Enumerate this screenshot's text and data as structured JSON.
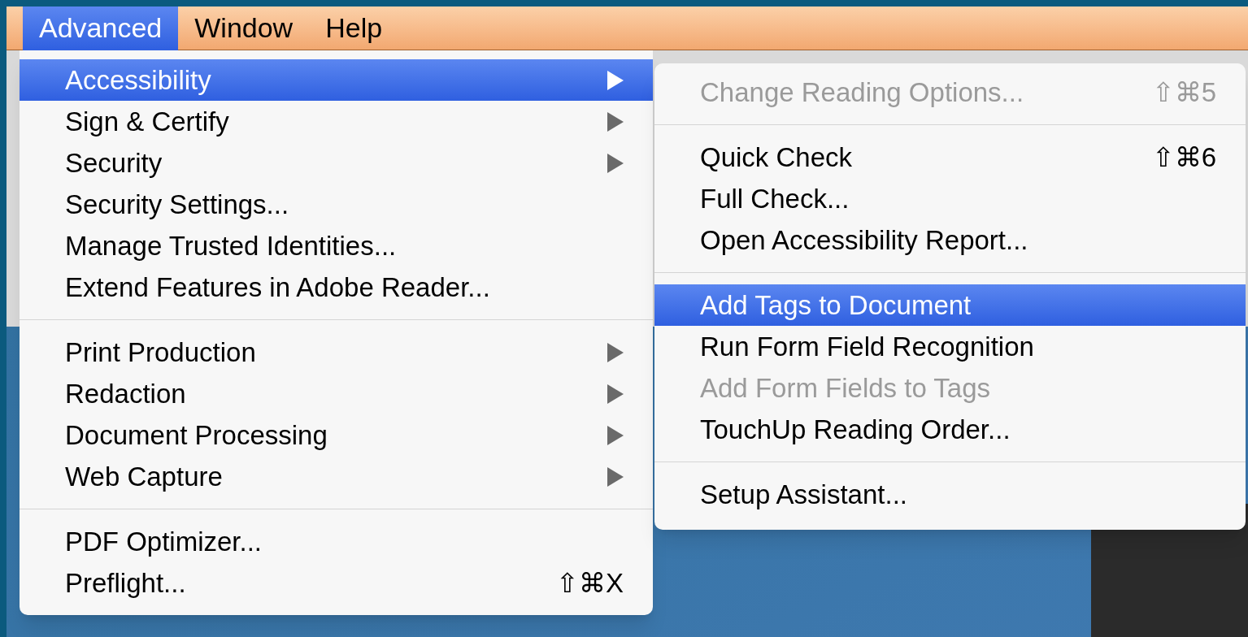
{
  "menubar": [
    {
      "label": "Advanced",
      "selected": true
    },
    {
      "label": "Window",
      "selected": false
    },
    {
      "label": "Help",
      "selected": false
    }
  ],
  "menu": [
    {
      "kind": "item",
      "label": "Accessibility",
      "has_submenu": true,
      "selected": true,
      "disabled": false
    },
    {
      "kind": "item",
      "label": "Sign & Certify",
      "has_submenu": true,
      "selected": false,
      "disabled": false
    },
    {
      "kind": "item",
      "label": "Security",
      "has_submenu": true,
      "selected": false,
      "disabled": false
    },
    {
      "kind": "item",
      "label": "Security Settings...",
      "has_submenu": false,
      "selected": false,
      "disabled": false
    },
    {
      "kind": "item",
      "label": "Manage Trusted Identities...",
      "has_submenu": false,
      "selected": false,
      "disabled": false
    },
    {
      "kind": "item",
      "label": "Extend Features in Adobe Reader...",
      "has_submenu": false,
      "selected": false,
      "disabled": false
    },
    {
      "kind": "separator"
    },
    {
      "kind": "item",
      "label": "Print Production",
      "has_submenu": true,
      "selected": false,
      "disabled": false
    },
    {
      "kind": "item",
      "label": "Redaction",
      "has_submenu": true,
      "selected": false,
      "disabled": false
    },
    {
      "kind": "item",
      "label": "Document Processing",
      "has_submenu": true,
      "selected": false,
      "disabled": false
    },
    {
      "kind": "item",
      "label": "Web Capture",
      "has_submenu": true,
      "selected": false,
      "disabled": false
    },
    {
      "kind": "separator"
    },
    {
      "kind": "item",
      "label": "PDF Optimizer...",
      "has_submenu": false,
      "selected": false,
      "disabled": false
    },
    {
      "kind": "item",
      "label": "Preflight...",
      "shortcut": "⇧⌘X",
      "has_submenu": false,
      "selected": false,
      "disabled": false
    }
  ],
  "submenu": [
    {
      "kind": "item",
      "label": "Change Reading Options...",
      "shortcut": "⇧⌘5",
      "selected": false,
      "disabled": true
    },
    {
      "kind": "separator"
    },
    {
      "kind": "item",
      "label": "Quick Check",
      "shortcut": "⇧⌘6",
      "selected": false,
      "disabled": false
    },
    {
      "kind": "item",
      "label": "Full Check...",
      "selected": false,
      "disabled": false
    },
    {
      "kind": "item",
      "label": "Open Accessibility Report...",
      "selected": false,
      "disabled": false
    },
    {
      "kind": "separator"
    },
    {
      "kind": "item",
      "label": "Add Tags to Document",
      "selected": true,
      "disabled": false
    },
    {
      "kind": "item",
      "label": "Run Form Field Recognition",
      "selected": false,
      "disabled": false
    },
    {
      "kind": "item",
      "label": "Add Form Fields to Tags",
      "selected": false,
      "disabled": true
    },
    {
      "kind": "item",
      "label": "TouchUp Reading Order...",
      "selected": false,
      "disabled": false
    },
    {
      "kind": "separator"
    },
    {
      "kind": "item",
      "label": "Setup Assistant...",
      "selected": false,
      "disabled": false
    }
  ]
}
